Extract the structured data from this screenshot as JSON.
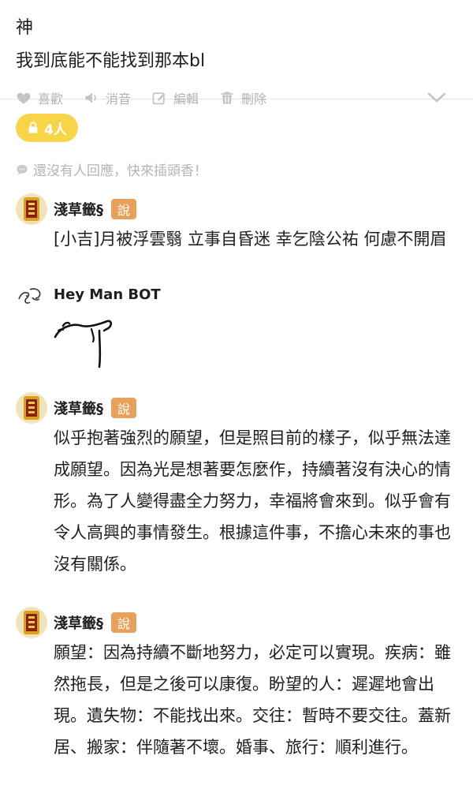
{
  "post": {
    "title": "神",
    "body": "我到底能不能找到那本bl"
  },
  "actions": {
    "like_label": "喜歡",
    "mute_label": "消音",
    "edit_label": "編輯",
    "delete_label": "刪除"
  },
  "badge": {
    "people_label": "4人"
  },
  "hint": {
    "text": "還沒有人回應，快來插頭香！"
  },
  "replies": [
    {
      "name": "淺草籤§",
      "tag": "說",
      "text": "[小吉]月被浮雲翳 立事自昏迷 幸乞陰公祐 何慮不開眉"
    },
    {
      "name": "Hey Man BOT",
      "tag": "",
      "text": ""
    },
    {
      "name": "淺草籤§",
      "tag": "說",
      "text": "似乎抱著強烈的願望，但是照目前的樣子，似乎無法達成願望。因為光是想著要怎麼作，持續著沒有決心的情形。為了人變得盡全力努力，幸福將會來到。似乎會有令人高興的事情發生。根據這件事，不擔心未來的事也沒有關係。"
    },
    {
      "name": "淺草籤§",
      "tag": "說",
      "text": "願望：因為持續不斷地努力，必定可以實現。疾病：雖然拖長，但是之後可以康復。盼望的人：遲遲地會出現。遺失物：不能找出來。交往：暫時不要交往。蓋新居、搬家：伴隨著不壞。婚事、旅行：順利進行。"
    }
  ],
  "colors": {
    "badge": "#f7d44a",
    "tag": "#e8a15b",
    "muted": "#b2b2b2"
  },
  "icons": [
    "heart-icon",
    "speaker-icon",
    "edit-icon",
    "trash-icon",
    "chevron-down-icon",
    "lock-icon",
    "chat-bubble-icon"
  ]
}
